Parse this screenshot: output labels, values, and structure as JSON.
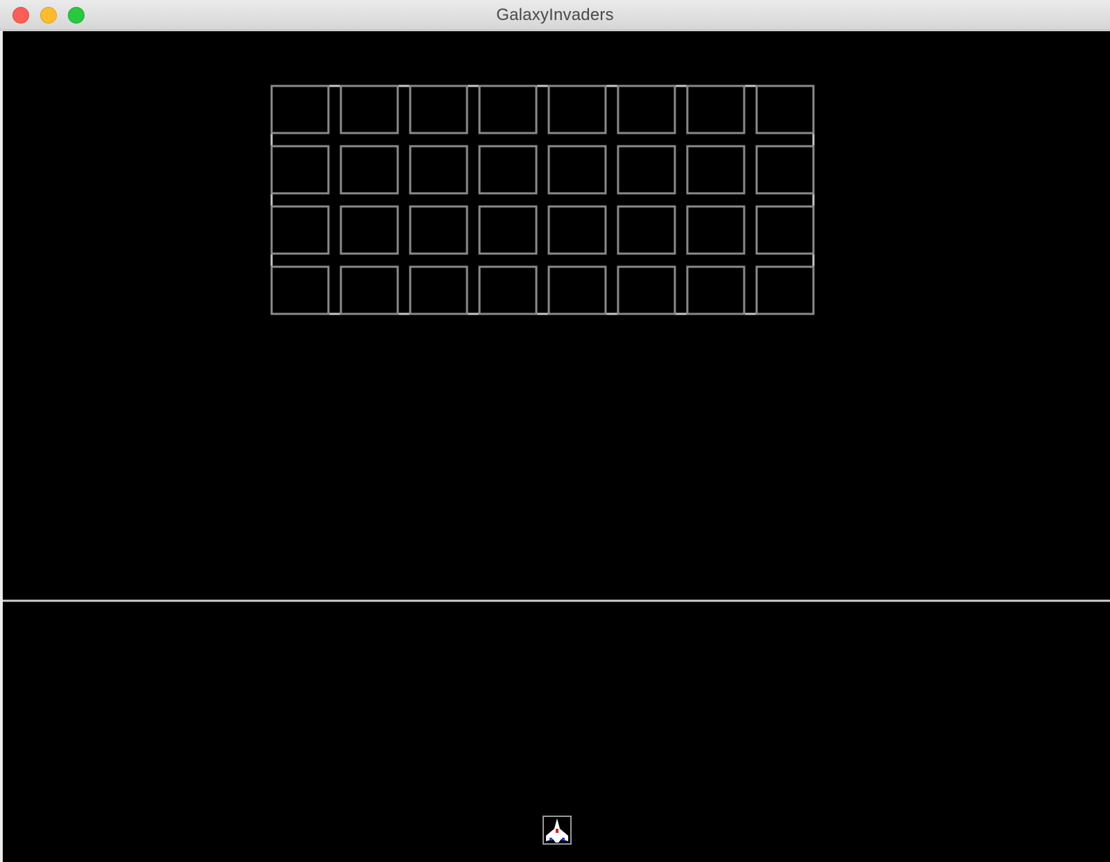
{
  "window": {
    "title": "GalaxyInvaders",
    "controls": {
      "close": "close-button",
      "minimize": "minimize-button",
      "zoom": "zoom-button"
    }
  },
  "game": {
    "background_color": "#000000",
    "invader_grid": {
      "rows": 4,
      "columns": 8,
      "outline_color": "#8a8a8a",
      "frame_color": "#c8c8c8"
    },
    "boundary_line_color": "#d0d0d0",
    "player_ship": {
      "icon": "fighter-ship-icon",
      "body_color": "#ffffff",
      "accent_color": "#d42020",
      "engine_color": "#2040c0"
    }
  }
}
